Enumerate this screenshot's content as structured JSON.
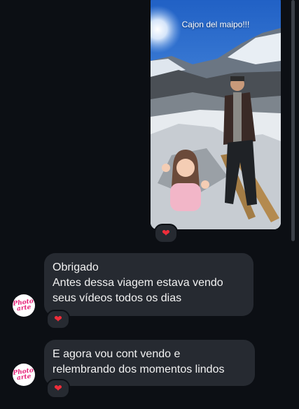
{
  "story": {
    "caption": "Cajon del maipo!!!",
    "reaction_emoji": "❤"
  },
  "messages": [
    {
      "lines": [
        "Obrigado",
        "Antes dessa viagem estava vendo",
        "seus vídeos todos os dias"
      ],
      "reaction_emoji": "❤"
    },
    {
      "lines": [
        "E agora vou cont vendo e",
        "relembrando dos momentos lindos"
      ],
      "reaction_emoji": "❤"
    }
  ],
  "avatar": {
    "logo_text": [
      "Photo",
      "arte"
    ],
    "brand_color": "#e6247a"
  },
  "colors": {
    "background": "#0c0f14",
    "bubble": "#262a31",
    "heart": "#ef2d3a"
  }
}
